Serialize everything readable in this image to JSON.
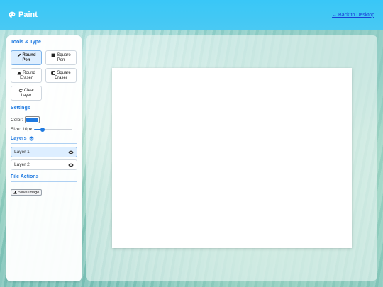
{
  "app": {
    "title": "Paint",
    "back_link": "← Back to Desktop"
  },
  "tools": {
    "title": "Tools & Type",
    "buttons": [
      {
        "icon": "pen-icon",
        "line1": "Round",
        "line2": "Pen",
        "active": true
      },
      {
        "icon": "square-icon",
        "line1": "Square",
        "line2": "Pen",
        "active": false
      },
      {
        "icon": "eraser-icon",
        "line1": "Round",
        "line2": "Eraser",
        "active": false
      },
      {
        "icon": "square-eraser-icon",
        "line1": "Square",
        "line2": "Eraser",
        "active": false
      },
      {
        "icon": "refresh-icon",
        "line1": "Clear",
        "line2": "Layer",
        "active": false
      }
    ]
  },
  "settings": {
    "title": "Settings",
    "color_label": "Color:",
    "color_value": "#1f7ae0",
    "size_label": "Size: 10px",
    "size_fraction": 0.22
  },
  "layers": {
    "title": "Layers",
    "items": [
      {
        "label": "Layer 1",
        "active": true
      },
      {
        "label": "Layer 2",
        "active": false
      }
    ]
  },
  "file_actions": {
    "title": "File Actions",
    "save_label": "Save Image"
  },
  "colors": {
    "header": "#39c7f7",
    "accent": "#1f7ae0",
    "link": "#1a3fd6"
  }
}
